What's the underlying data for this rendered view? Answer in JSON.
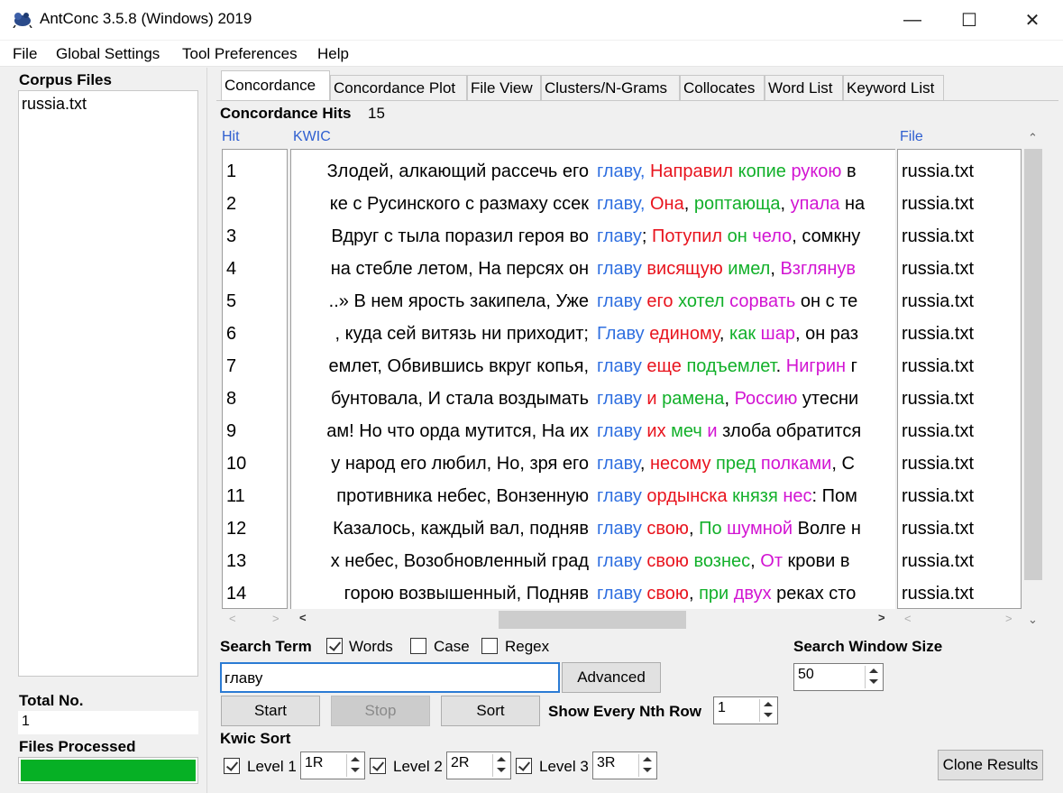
{
  "window": {
    "title": "AntConc 3.5.8 (Windows) 2019",
    "minimize": "—",
    "maximize": "☐",
    "close": "✕"
  },
  "menu": [
    "File",
    "Global Settings",
    "Tool Preferences",
    "Help"
  ],
  "left": {
    "corpus_files_label": "Corpus Files",
    "files": [
      "russia.txt"
    ],
    "total_no_label": "Total No.",
    "total_no": "1",
    "files_processed_label": "Files Processed",
    "progress_fraction": 1.0
  },
  "tabs": [
    "Concordance",
    "Concordance Plot",
    "File View",
    "Clusters/N-Grams",
    "Collocates",
    "Word List",
    "Keyword List"
  ],
  "active_tab": "Concordance",
  "hits": {
    "label": "Concordance Hits",
    "count": "15"
  },
  "columns": {
    "hit": "Hit",
    "kwic": "KWIC",
    "file": "File"
  },
  "rows": [
    {
      "n": "1",
      "left": "Злодей, алкающий рассечь его",
      "kw": "главу",
      "right": [
        {
          "t": ", ",
          "c": "kw"
        },
        {
          "t": "Направил",
          "c": "r1"
        },
        {
          "t": " ",
          "c": ""
        },
        {
          "t": "копие",
          "c": "r2"
        },
        {
          "t": " ",
          "c": ""
        },
        {
          "t": "рукою",
          "c": "r3"
        },
        {
          "t": " в",
          "c": ""
        }
      ],
      "file": "russia.txt"
    },
    {
      "n": "2",
      "left": "ке с Русинского с размаху ссек",
      "kw": "главу",
      "right": [
        {
          "t": ", ",
          "c": "kw"
        },
        {
          "t": "Она",
          "c": "r1"
        },
        {
          "t": ", ",
          "c": ""
        },
        {
          "t": "роптающа",
          "c": "r2"
        },
        {
          "t": ", ",
          "c": ""
        },
        {
          "t": "упала",
          "c": "r3"
        },
        {
          "t": " на",
          "c": ""
        }
      ],
      "file": "russia.txt"
    },
    {
      "n": "3",
      "left": "Вдруг с тыла поразил героя во",
      "kw": "главу",
      "right": [
        {
          "t": "; ",
          "c": ""
        },
        {
          "t": "Потупил",
          "c": "r1"
        },
        {
          "t": " ",
          "c": ""
        },
        {
          "t": "он",
          "c": "r2"
        },
        {
          "t": " ",
          "c": ""
        },
        {
          "t": "чело",
          "c": "r3"
        },
        {
          "t": ", сомкну",
          "c": ""
        }
      ],
      "file": "russia.txt"
    },
    {
      "n": "4",
      "left": "на стебле летом, На персях он",
      "kw": "главу",
      "right": [
        {
          "t": " ",
          "c": ""
        },
        {
          "t": "висящую",
          "c": "r1"
        },
        {
          "t": " ",
          "c": ""
        },
        {
          "t": "имел",
          "c": "r2"
        },
        {
          "t": ", ",
          "c": ""
        },
        {
          "t": "Взглянув",
          "c": "r3"
        }
      ],
      "file": "russia.txt"
    },
    {
      "n": "5",
      "left": "..» В нем ярость закипела, Уже",
      "kw": "главу",
      "right": [
        {
          "t": " ",
          "c": ""
        },
        {
          "t": "его",
          "c": "r1"
        },
        {
          "t": " ",
          "c": ""
        },
        {
          "t": "хотел",
          "c": "r2"
        },
        {
          "t": " ",
          "c": ""
        },
        {
          "t": "сорвать",
          "c": "r3"
        },
        {
          "t": " он с те",
          "c": ""
        }
      ],
      "file": "russia.txt"
    },
    {
      "n": "6",
      "left": ", куда сей витязь ни приходит;",
      "kw": "Главу",
      "right": [
        {
          "t": " ",
          "c": ""
        },
        {
          "t": "единому",
          "c": "r1"
        },
        {
          "t": ", ",
          "c": ""
        },
        {
          "t": "как",
          "c": "r2"
        },
        {
          "t": " ",
          "c": ""
        },
        {
          "t": "шар",
          "c": "r3"
        },
        {
          "t": ", он раз",
          "c": ""
        }
      ],
      "file": "russia.txt"
    },
    {
      "n": "7",
      "left": "емлет, Обвившись вкруг копья,",
      "kw": "главу",
      "right": [
        {
          "t": " ",
          "c": ""
        },
        {
          "t": "еще",
          "c": "r1"
        },
        {
          "t": " ",
          "c": ""
        },
        {
          "t": "подъемлет",
          "c": "r2"
        },
        {
          "t": ". ",
          "c": ""
        },
        {
          "t": "Нигрин",
          "c": "r3"
        },
        {
          "t": " г",
          "c": ""
        }
      ],
      "file": "russia.txt"
    },
    {
      "n": "8",
      "left": "бунтовала, И стала воздымать",
      "kw": "главу",
      "right": [
        {
          "t": " ",
          "c": ""
        },
        {
          "t": "и",
          "c": "r1"
        },
        {
          "t": " ",
          "c": ""
        },
        {
          "t": "рамена",
          "c": "r2"
        },
        {
          "t": ", ",
          "c": ""
        },
        {
          "t": "Россию",
          "c": "r3"
        },
        {
          "t": " утесни",
          "c": ""
        }
      ],
      "file": "russia.txt"
    },
    {
      "n": "9",
      "left": "ам! Но что орда мутится, На их",
      "kw": "главу",
      "right": [
        {
          "t": " ",
          "c": ""
        },
        {
          "t": "их",
          "c": "r1"
        },
        {
          "t": " ",
          "c": ""
        },
        {
          "t": "меч",
          "c": "r2"
        },
        {
          "t": " ",
          "c": ""
        },
        {
          "t": "и",
          "c": "r3"
        },
        {
          "t": " злоба обратится",
          "c": ""
        }
      ],
      "file": "russia.txt"
    },
    {
      "n": "10",
      "left": "у народ его любил, Но, зря его",
      "kw": "главу",
      "right": [
        {
          "t": ", ",
          "c": ""
        },
        {
          "t": "несому",
          "c": "r1"
        },
        {
          "t": " ",
          "c": ""
        },
        {
          "t": "пред",
          "c": "r2"
        },
        {
          "t": " ",
          "c": ""
        },
        {
          "t": "полками",
          "c": "r3"
        },
        {
          "t": ", С",
          "c": ""
        }
      ],
      "file": "russia.txt"
    },
    {
      "n": "11",
      "left": "противника небес, Вонзенную",
      "kw": "главу",
      "right": [
        {
          "t": " ",
          "c": ""
        },
        {
          "t": "ордынска",
          "c": "r1"
        },
        {
          "t": " ",
          "c": ""
        },
        {
          "t": "князя",
          "c": "r2"
        },
        {
          "t": " ",
          "c": ""
        },
        {
          "t": "нес",
          "c": "r3"
        },
        {
          "t": ": Пом",
          "c": ""
        }
      ],
      "file": "russia.txt"
    },
    {
      "n": "12",
      "left": "Казалось, каждый вал, подняв",
      "kw": "главу",
      "right": [
        {
          "t": " ",
          "c": ""
        },
        {
          "t": "свою",
          "c": "r1"
        },
        {
          "t": ", ",
          "c": ""
        },
        {
          "t": "По",
          "c": "r2"
        },
        {
          "t": " ",
          "c": ""
        },
        {
          "t": "шумной",
          "c": "r3"
        },
        {
          "t": " Волге н",
          "c": ""
        }
      ],
      "file": "russia.txt"
    },
    {
      "n": "13",
      "left": "х небес, Возобновленный град",
      "kw": "главу",
      "right": [
        {
          "t": " ",
          "c": ""
        },
        {
          "t": "свою",
          "c": "r1"
        },
        {
          "t": " ",
          "c": ""
        },
        {
          "t": "вознес",
          "c": "r2"
        },
        {
          "t": ",  ",
          "c": ""
        },
        {
          "t": "От",
          "c": "r3"
        },
        {
          "t": " крови в",
          "c": ""
        }
      ],
      "file": "russia.txt"
    },
    {
      "n": "14",
      "left": "горою возвышенный, Подняв",
      "kw": "главу",
      "right": [
        {
          "t": " ",
          "c": ""
        },
        {
          "t": "свою",
          "c": "r1"
        },
        {
          "t": ", ",
          "c": ""
        },
        {
          "t": "при",
          "c": "r2"
        },
        {
          "t": " ",
          "c": ""
        },
        {
          "t": "двух",
          "c": "r3"
        },
        {
          "t": " реках сто",
          "c": ""
        }
      ],
      "file": "russia.txt"
    }
  ],
  "search": {
    "term_label": "Search Term",
    "words_label": "Words",
    "case_label": "Case",
    "regex_label": "Regex",
    "words_checked": true,
    "case_checked": false,
    "regex_checked": false,
    "value": "главу",
    "advanced": "Advanced",
    "window_size_label": "Search Window Size",
    "window_size": "50"
  },
  "buttons": {
    "start": "Start",
    "stop": "Stop",
    "sort": "Sort",
    "clone": "Clone Results"
  },
  "nth_row": {
    "label": "Show Every Nth Row",
    "value": "1"
  },
  "kwic_sort": {
    "label": "Kwic Sort",
    "levels": [
      {
        "label": "Level 1",
        "value": "1R"
      },
      {
        "label": "Level 2",
        "value": "2R"
      },
      {
        "label": "Level 3",
        "value": "3R"
      }
    ]
  },
  "colors": {
    "keyword": "#2f6fe0",
    "level1": "#e8141e",
    "level2": "#12b02a",
    "level3": "#d214d2",
    "header": "#2f5fd0",
    "progress": "#06b025"
  }
}
